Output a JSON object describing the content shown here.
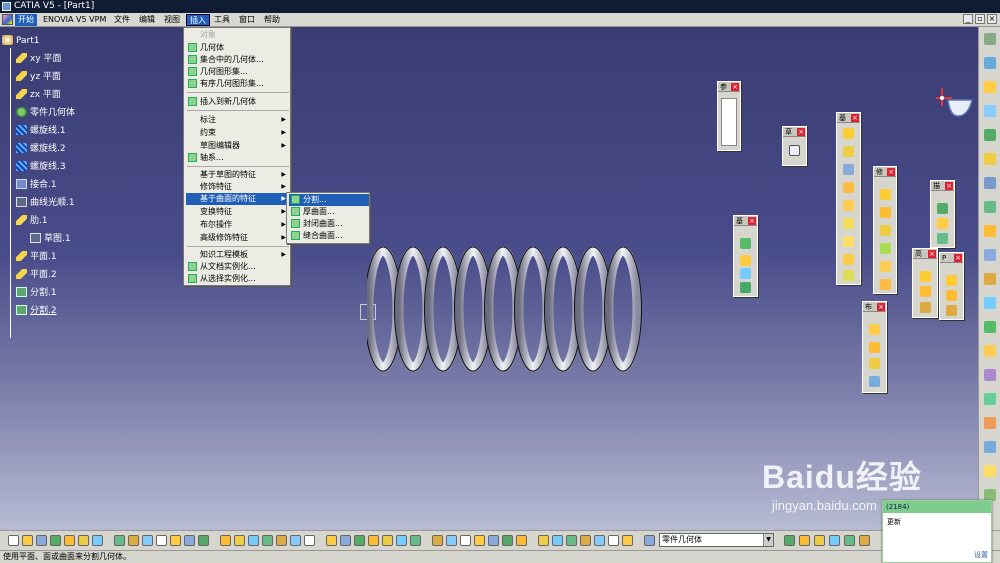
{
  "window": {
    "title": "CATIA V5 - [Part1]"
  },
  "menubar": {
    "items": [
      "开始",
      "ENOVIA V5 VPM",
      "文件",
      "编辑",
      "视图",
      "插入",
      "工具",
      "窗口",
      "帮助"
    ],
    "active_index": 5
  },
  "tree": {
    "root": "Part1",
    "nodes": [
      {
        "label": "xy 平面",
        "icon": "plane-icon"
      },
      {
        "label": "yz 平面",
        "icon": "plane-icon"
      },
      {
        "label": "zx 平面",
        "icon": "plane-icon"
      },
      {
        "label": "零件几何体",
        "icon": "body-icon"
      },
      {
        "label": "螺旋线.1",
        "icon": "helix-icon"
      },
      {
        "label": "螺旋线.2",
        "icon": "helix-icon"
      },
      {
        "label": "螺旋线.3",
        "icon": "helix-icon"
      },
      {
        "label": "接合.1",
        "icon": "join-icon"
      },
      {
        "label": "曲线光顺.1",
        "icon": "curve-smooth-icon"
      },
      {
        "label": "肋.1",
        "icon": "rib-icon"
      },
      {
        "label": "草图.1",
        "icon": "sketch-icon"
      },
      {
        "label": "平面.1",
        "icon": "plane-icon"
      },
      {
        "label": "平面.2",
        "icon": "plane-icon"
      },
      {
        "label": "分割.1",
        "icon": "split-icon"
      },
      {
        "label": "分割.2",
        "icon": "split-icon"
      }
    ]
  },
  "insert_menu": {
    "items": [
      {
        "label": "对象",
        "disabled": true
      },
      {
        "label": "几何体",
        "icon": true
      },
      {
        "label": "集合中的几何体...",
        "icon": true
      },
      {
        "label": "几何图形集...",
        "icon": true
      },
      {
        "label": "有序几何图形集...",
        "icon": true
      },
      {
        "label": "插入到新几何体",
        "icon": true
      },
      {
        "label": "标注",
        "submenu": true
      },
      {
        "label": "约束",
        "submenu": true
      },
      {
        "label": "草图编辑器",
        "submenu": true
      },
      {
        "label": "轴系...",
        "icon": true
      },
      {
        "label": "基于草图的特征",
        "submenu": true
      },
      {
        "label": "修饰特征",
        "submenu": true
      },
      {
        "label": "基于曲面的特征",
        "submenu": true,
        "highlighted": true
      },
      {
        "label": "变换特征",
        "submenu": true
      },
      {
        "label": "布尔操作",
        "submenu": true
      },
      {
        "label": "高级修饰特征",
        "submenu": true
      },
      {
        "label": "知识工程模板",
        "submenu": true
      },
      {
        "label": "从文档实例化...",
        "icon": true
      },
      {
        "label": "从选择实例化...",
        "icon": true
      }
    ]
  },
  "surface_submenu": {
    "items": [
      {
        "label": "分割...",
        "highlighted": true
      },
      {
        "label": "厚曲面..."
      },
      {
        "label": "封闭曲面..."
      },
      {
        "label": "缝合曲面..."
      }
    ]
  },
  "floating_toolbars": [
    {
      "title": "参",
      "buttons": 3
    },
    {
      "title": "草",
      "buttons": 1
    },
    {
      "title": "基",
      "buttons": 9
    },
    {
      "title": "修",
      "buttons": 6
    },
    {
      "title": "基",
      "buttons": 4
    },
    {
      "title": "描",
      "buttons": 3
    },
    {
      "title": "高",
      "buttons": 3
    },
    {
      "title": "P",
      "buttons": 3
    },
    {
      "title": "布",
      "buttons": 4
    }
  ],
  "command_field": {
    "value": "零件几何体"
  },
  "status": {
    "text": "使用平面、面或曲面来分割几何体。"
  },
  "popup": {
    "header": "(2184)",
    "body": "更新",
    "footer": "设置"
  },
  "watermark": {
    "brand": "Baidu经验",
    "url": "jingyan.baidu.com"
  },
  "colors": {
    "background_top": "#3a3c72",
    "background_bottom": "#b8bbd4",
    "menu_highlight": "#1f5fb8"
  }
}
